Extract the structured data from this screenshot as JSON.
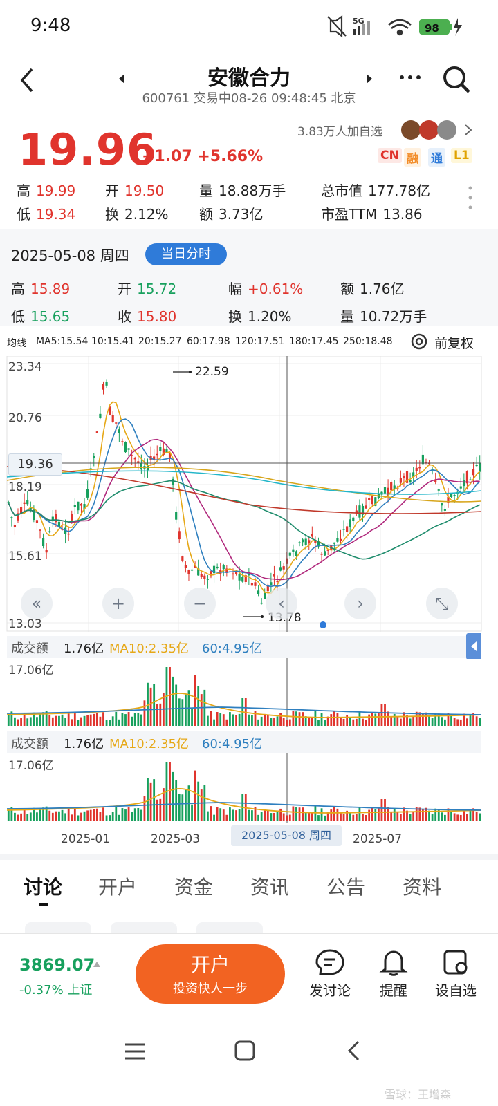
{
  "status_bar": {
    "time": "9:48",
    "network": "5G",
    "battery": "98"
  },
  "header": {
    "title": "安徽合力",
    "subtitle": "600761 交易中08-26 09:48:45 北京"
  },
  "quote": {
    "price": "19.96",
    "change": "+1.07 +5.66%",
    "followers": "3.83万人加自选",
    "badges": [
      "CN",
      "融",
      "通",
      "L1"
    ],
    "stats": [
      {
        "label": "高",
        "value": "19.99",
        "color": "red"
      },
      {
        "label": "开",
        "value": "19.50",
        "color": "red"
      },
      {
        "label": "量",
        "value": "18.88万手",
        "color": "none"
      },
      {
        "label": "总市值",
        "value": "177.78亿",
        "color": "none"
      },
      {
        "label": "低",
        "value": "19.34",
        "color": "red"
      },
      {
        "label": "换",
        "value": "2.12%",
        "color": "none"
      },
      {
        "label": "额",
        "value": "3.73亿",
        "color": "none"
      },
      {
        "label": "市盈TTM",
        "value": "13.86",
        "color": "none"
      }
    ]
  },
  "day_detail": {
    "date": "2025-05-08 周四",
    "button": "当日分时",
    "stats": [
      {
        "label": "高",
        "value": "15.89",
        "color": "red"
      },
      {
        "label": "开",
        "value": "15.72",
        "color": "green"
      },
      {
        "label": "幅",
        "value": "+0.61%",
        "color": "red"
      },
      {
        "label": "额",
        "value": "1.76亿",
        "color": "none"
      },
      {
        "label": "低",
        "value": "15.65",
        "color": "green"
      },
      {
        "label": "收",
        "value": "15.80",
        "color": "red"
      },
      {
        "label": "换",
        "value": "1.20%",
        "color": "none"
      },
      {
        "label": "量",
        "value": "10.72万手",
        "color": "none"
      }
    ]
  },
  "ma_legend": {
    "prefix": "均线",
    "items": [
      {
        "text": "MA5:15.54",
        "color": "#e6a817"
      },
      {
        "text": "10:15.41",
        "color": "#2e7fbf"
      },
      {
        "text": "20:15.27",
        "color": "#b0287c"
      },
      {
        "text": "60:17.98",
        "color": "#1e8c6c"
      },
      {
        "text": "120:17.51",
        "color": "#d7a51b"
      },
      {
        "text": "180:17.45",
        "color": "#c0392b"
      },
      {
        "text": "250:18.48",
        "color": "#23b6c9"
      }
    ],
    "adjust": "前复权"
  },
  "chart_data": {
    "type": "candlestick",
    "y_ticks": [
      "23.34",
      "20.76",
      "18.19",
      "15.61",
      "13.03"
    ],
    "crosshair_value": "19.36",
    "max_label": "22.59",
    "min_label": "13.78",
    "x_ticks": [
      "2025-01",
      "2025-03",
      "2025-07"
    ],
    "selected_date": "2025-05-08 周四"
  },
  "volume": {
    "label": "成交额",
    "value": "1.76亿",
    "ma10": "MA10:2.35亿",
    "ma60": "60:4.95亿",
    "max": "17.06亿"
  },
  "tabs": [
    "讨论",
    "开户",
    "资金",
    "资讯",
    "公告",
    "资料"
  ],
  "bottom": {
    "index_value": "3869.07",
    "index_change": "-0.37% 上证",
    "open_account": "开户",
    "open_account_sub": "投资快人一步",
    "post": "发讨论",
    "remind": "提醒",
    "watch": "设自选"
  },
  "watermark": "雪球：王增森",
  "colors": {
    "up": "#e0342d",
    "down": "#17a05d",
    "accent": "#2f7bd9",
    "cta": "#f26322"
  }
}
